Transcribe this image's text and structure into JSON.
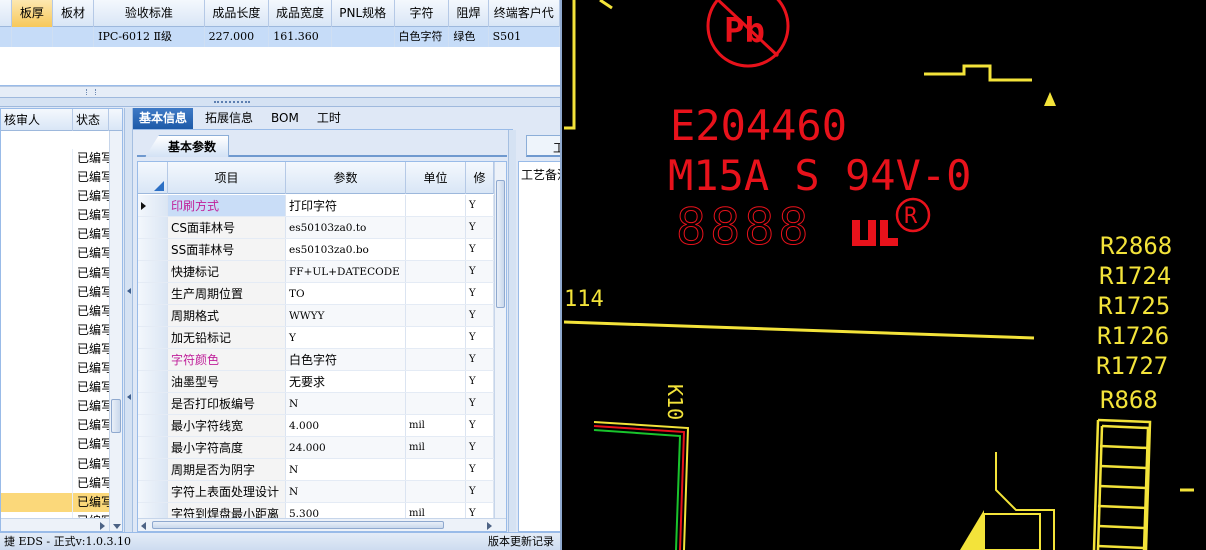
{
  "top_grid": {
    "columns": [
      "板厚",
      "板材",
      "验收标准",
      "成品长度",
      "成品宽度",
      "PNL规格",
      "字符",
      "阻焊",
      "终端客户代"
    ],
    "row": [
      "",
      "",
      "IPC-6012 Ⅱ级",
      "227.000",
      "161.360",
      "",
      "白色字符",
      "绿色",
      "S501"
    ]
  },
  "list_panel": {
    "columns": [
      "核审人",
      "状态"
    ],
    "status_values": [
      "已编写",
      "已编写",
      "已编写",
      "已编写",
      "已编写",
      "已编写",
      "已编写",
      "已编写",
      "已编写",
      "已编写",
      "已编写",
      "已编写",
      "已编写",
      "已编写",
      "已编写",
      "已编写",
      "已编写",
      "已编写",
      "已编写",
      "已编写"
    ],
    "selected_index": 18
  },
  "tabs": [
    "基本信息",
    "拓展信息",
    "BOM",
    "工时"
  ],
  "active_tab": "基本信息",
  "inner_tab": "基本参数",
  "param_grid": {
    "columns": [
      "项目",
      "参数",
      "单位",
      "修"
    ],
    "rows": [
      {
        "item": "印刷方式",
        "param": "打印字符",
        "unit": "",
        "flag": "Y"
      },
      {
        "item": "CS面菲林号",
        "param": "es50103za0.to",
        "unit": "",
        "flag": "Y"
      },
      {
        "item": "SS面菲林号",
        "param": "es50103za0.bo",
        "unit": "",
        "flag": "Y"
      },
      {
        "item": "快捷标记",
        "param": "FF+UL+DATECODE",
        "unit": "",
        "flag": "Y"
      },
      {
        "item": "生产周期位置",
        "param": "TO",
        "unit": "",
        "flag": "Y"
      },
      {
        "item": "周期格式",
        "param": "WWYY",
        "unit": "",
        "flag": "Y"
      },
      {
        "item": "加无铅标记",
        "param": "Y",
        "unit": "",
        "flag": "Y"
      },
      {
        "item": "字符颜色",
        "param": "白色字符",
        "unit": "",
        "flag": "Y"
      },
      {
        "item": "油墨型号",
        "param": "无要求",
        "unit": "",
        "flag": "Y"
      },
      {
        "item": "是否打印板编号",
        "param": "N",
        "unit": "",
        "flag": "Y"
      },
      {
        "item": "最小字符线宽",
        "param": "4.000",
        "unit": "mil",
        "flag": "Y"
      },
      {
        "item": "最小字符高度",
        "param": "24.000",
        "unit": "mil",
        "flag": "Y"
      },
      {
        "item": "周期是否为阴字",
        "param": "N",
        "unit": "",
        "flag": "Y"
      },
      {
        "item": "字符上表面处理设计",
        "param": "N",
        "unit": "",
        "flag": "Y"
      },
      {
        "item": "字符到焊盘最小距离",
        "param": "5.300",
        "unit": "mil",
        "flag": "Y"
      }
    ]
  },
  "right_panel": {
    "tab_label": "工",
    "label": "工艺备注"
  },
  "status_bar": {
    "left": "捷 EDS - 正式v:1.0.3.10",
    "right": "版本更新记录"
  },
  "cad": {
    "texts_red": [
      "E204460",
      "M15A S 94V-0",
      "8888",
      "Pb"
    ],
    "texts_yellow": [
      "R2868",
      "R1724",
      "R1725",
      "R1726",
      "R1727",
      "R868",
      "114",
      "K10"
    ],
    "colors": {
      "background": "#000000",
      "red": "#e8121b",
      "yellow": "#f3e33a",
      "green": "#19c42c"
    }
  }
}
